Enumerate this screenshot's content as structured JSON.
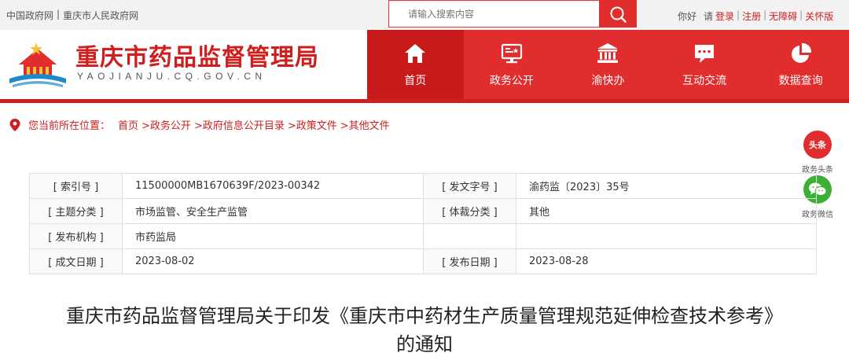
{
  "topbar": {
    "links": [
      "中国政府网",
      "重庆市人民政府网"
    ],
    "separator": "|",
    "search_placeholder": "请输入搜索内容",
    "greeting": "你好",
    "please": "请",
    "login": "登录",
    "register": "注册",
    "accessibility": "无障碍",
    "elderly": "关怀版"
  },
  "header": {
    "title": "重庆市药品监督管理局",
    "domain": "YAOJIANJU.CQ.GOV.CN"
  },
  "nav": [
    {
      "label": "首页",
      "icon": "home-icon",
      "active": true
    },
    {
      "label": "政务公开",
      "icon": "screen-icon",
      "active": false
    },
    {
      "label": "渝快办",
      "icon": "government-building-icon",
      "active": false
    },
    {
      "label": "互动交流",
      "icon": "chat-icon",
      "active": false
    },
    {
      "label": "数据查询",
      "icon": "pie-chart-icon",
      "active": false
    }
  ],
  "breadcrumb": {
    "prefix": "您当前所在位置：",
    "items": [
      "首页",
      ">政务公开",
      ">政府信息公开目录",
      ">政策文件",
      ">其他文件"
    ]
  },
  "side": {
    "toutiao_icon_text": "头条",
    "toutiao_label": "政务头条",
    "wechat_label": "政务微信"
  },
  "meta": {
    "index_no_label": "[ 索引号 ]",
    "index_no": "11500000MB1670639F/2023-00342",
    "doc_no_label": "[ 发文字号 ]",
    "doc_no": "渝药监〔2023〕35号",
    "topic_label": "[ 主题分类 ]",
    "topic": "市场监管、安全生产监管",
    "genre_label": "[ 体裁分类 ]",
    "genre": "其他",
    "publisher_label": "[ 发布机构 ]",
    "publisher": "市药监局",
    "created_label": "[ 成文日期 ]",
    "created": "2023-08-02",
    "published_label": "[ 发布日期 ]",
    "published": "2023-08-28"
  },
  "article": {
    "title_line1": "重庆市药品监督管理局关于印发《重庆市中药材生产质量管理规范延伸检查技术参考》",
    "title_line2": "的通知"
  },
  "colors": {
    "brand_red": "#e12d2d",
    "active_red": "#c81a1a",
    "wechat_green": "#3cb034"
  }
}
